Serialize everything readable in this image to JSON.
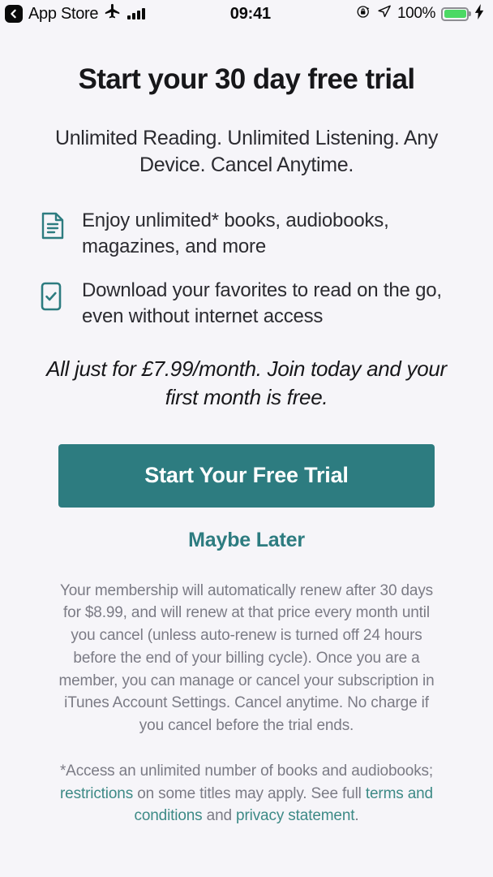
{
  "status_bar": {
    "back_label": "App Store",
    "back_icon": "chevron-left-icon",
    "airplane_icon": "airplane-mode-icon",
    "signal_icon": "cellular-signal-icon",
    "time": "09:41",
    "rotation_lock_icon": "rotation-lock-icon",
    "location_icon": "location-arrow-icon",
    "battery_percent": "100%",
    "battery_icon": "battery-full-icon",
    "charging_icon": "charging-bolt-icon",
    "battery_color": "#4cd964"
  },
  "headline": "Start your 30 day free trial",
  "subhead": "Unlimited Reading. Unlimited Listening. Any Device. Cancel Anytime.",
  "features": [
    {
      "icon": "document-lines-icon",
      "text": "Enjoy unlimited* books, audiobooks, magazines, and more"
    },
    {
      "icon": "phone-checkmark-icon",
      "text": "Download your favorites to read on the go, even without internet access"
    }
  ],
  "price_note": "All just for £7.99/month. Join today and your first month is free.",
  "cta": {
    "primary_label": "Start Your Free Trial",
    "secondary_label": "Maybe Later"
  },
  "disclaimer": "Your membership will automatically renew after 30 days for $8.99, and will renew at that price every month until you cancel (unless auto-renew is turned off 24 hours before the end of your billing cycle). Once you are a member, you can manage or cancel your subscription in iTunes Account Settings. Cancel anytime. No charge if you cancel before the trial ends.",
  "footnote": {
    "part1": "*Access an unlimited number of books and audiobooks; ",
    "link1": "restrictions",
    "part2": " on some titles may apply. See full ",
    "link2": "terms and conditions",
    "part3": " and ",
    "link3": "privacy statement",
    "part4": "."
  },
  "colors": {
    "accent_teal": "#2d7c80",
    "link_teal": "#3d8a86",
    "background": "#f6f5f9"
  }
}
